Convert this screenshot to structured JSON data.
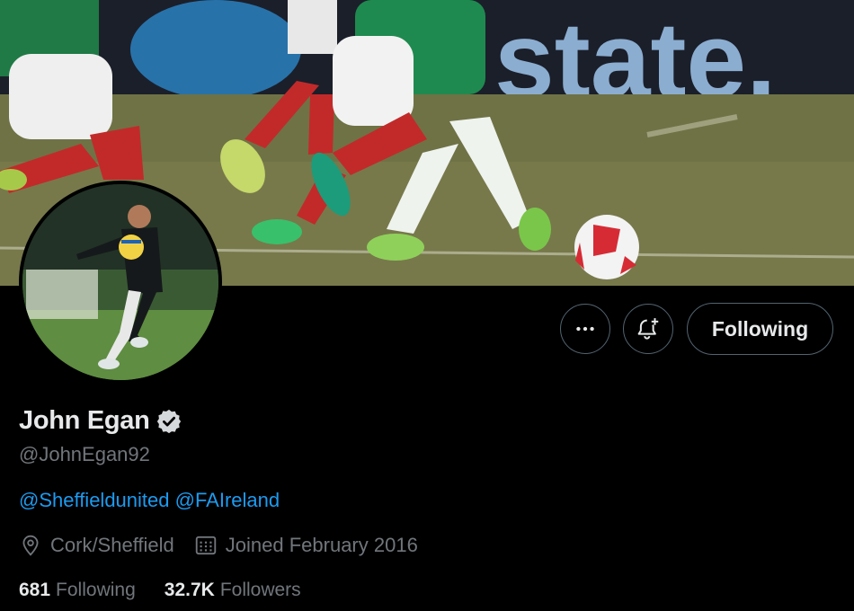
{
  "banner": {
    "description": "football players on pitch",
    "sponsor_text": "state."
  },
  "profile": {
    "display_name": "John Egan",
    "handle": "@JohnEgan92",
    "bio_links": [
      "@Sheffieldunited",
      "@FAIreland"
    ],
    "location": "Cork/Sheffield",
    "joined": "Joined February 2016",
    "following_count": "681",
    "following_label": "Following",
    "followers_count": "32.7K",
    "followers_label": "Followers"
  },
  "actions": {
    "more_icon": "more-horizontal-icon",
    "notify_icon": "bell-plus-icon",
    "follow_label": "Following"
  },
  "colors": {
    "background": "#000000",
    "link": "#1d9bf0",
    "muted": "#71767b",
    "text": "#e7e9ea",
    "border": "#536471"
  }
}
